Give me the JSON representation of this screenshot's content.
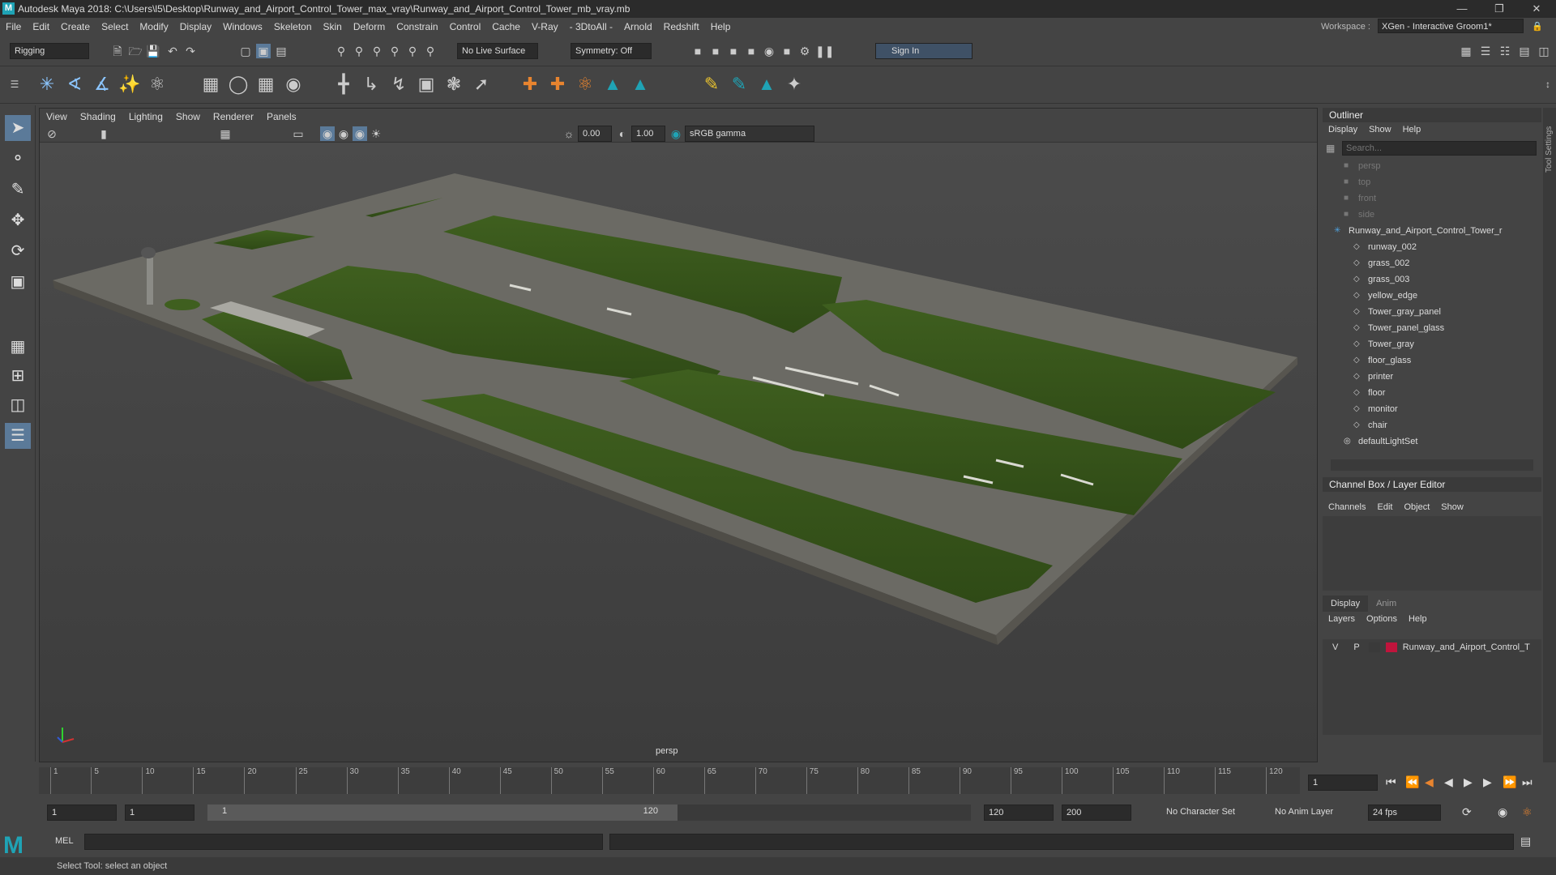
{
  "window": {
    "title": "Autodesk Maya 2018: C:\\Users\\l5\\Desktop\\Runway_and_Airport_Control_Tower_max_vray\\Runway_and_Airport_Control_Tower_mb_vray.mb",
    "logo": "M"
  },
  "menubar": [
    "File",
    "Edit",
    "Create",
    "Select",
    "Modify",
    "Display",
    "Windows",
    "Skeleton",
    "Skin",
    "Deform",
    "Constrain",
    "Control",
    "Cache",
    "V-Ray",
    "- 3DtoAll -",
    "Arnold",
    "Redshift",
    "Help"
  ],
  "workspace": {
    "label": "Workspace :",
    "value": "XGen - Interactive Groom1*"
  },
  "statusline": {
    "mode": "Rigging",
    "live_surface": "No Live Surface",
    "symmetry": "Symmetry: Off",
    "sign_in": "Sign In"
  },
  "viewport": {
    "menu": [
      "View",
      "Shading",
      "Lighting",
      "Show",
      "Renderer",
      "Panels"
    ],
    "exposure": "0.00",
    "gamma": "1.00",
    "colorspace": "sRGB gamma",
    "camera_label": "persp"
  },
  "outliner": {
    "title": "Outliner",
    "menu": [
      "Display",
      "Show",
      "Help"
    ],
    "search_placeholder": "Search...",
    "items": [
      {
        "label": "persp",
        "dim": true,
        "indent": 1
      },
      {
        "label": "top",
        "dim": true,
        "indent": 1
      },
      {
        "label": "front",
        "dim": true,
        "indent": 1
      },
      {
        "label": "side",
        "dim": true,
        "indent": 1
      },
      {
        "label": "Runway_and_Airport_Control_Tower_r",
        "dim": false,
        "indent": 0
      },
      {
        "label": "runway_002",
        "dim": false,
        "indent": 2
      },
      {
        "label": "grass_002",
        "dim": false,
        "indent": 2
      },
      {
        "label": "grass_003",
        "dim": false,
        "indent": 2
      },
      {
        "label": "yellow_edge",
        "dim": false,
        "indent": 2
      },
      {
        "label": "Tower_gray_panel",
        "dim": false,
        "indent": 2
      },
      {
        "label": "Tower_panel_glass",
        "dim": false,
        "indent": 2
      },
      {
        "label": "Tower_gray",
        "dim": false,
        "indent": 2
      },
      {
        "label": "floor_glass",
        "dim": false,
        "indent": 2
      },
      {
        "label": "printer",
        "dim": false,
        "indent": 2
      },
      {
        "label": "floor",
        "dim": false,
        "indent": 2
      },
      {
        "label": "monitor",
        "dim": false,
        "indent": 2
      },
      {
        "label": "chair",
        "dim": false,
        "indent": 2
      },
      {
        "label": "defaultLightSet",
        "dim": false,
        "indent": 1
      }
    ]
  },
  "channelbox": {
    "title": "Channel Box / Layer Editor",
    "menu": [
      "Channels",
      "Edit",
      "Object",
      "Show"
    ]
  },
  "layereditor": {
    "tabs": [
      "Display",
      "Anim"
    ],
    "menu": [
      "Layers",
      "Options",
      "Help"
    ],
    "layer": {
      "v": "V",
      "p": "P",
      "name": "Runway_and_Airport_Control_T",
      "color": "#c0143c"
    }
  },
  "toolsettings_label": "Tool Settings",
  "timeline": {
    "ticks": [
      "1",
      "5",
      "10",
      "15",
      "20",
      "25",
      "30",
      "35",
      "40",
      "45",
      "50",
      "55",
      "60",
      "65",
      "70",
      "75",
      "80",
      "85",
      "90",
      "95",
      "100",
      "105",
      "110",
      "115",
      "120"
    ],
    "current_frame": "1"
  },
  "range": {
    "start": "1",
    "anim_start": "1",
    "slider_start": "1",
    "slider_end": "120",
    "end": "120",
    "anim_end": "200",
    "character_set": "No Character Set",
    "anim_layer": "No Anim Layer",
    "fps": "24 fps"
  },
  "cmdline": {
    "label": "MEL"
  },
  "helpline": "Select Tool: select an object"
}
